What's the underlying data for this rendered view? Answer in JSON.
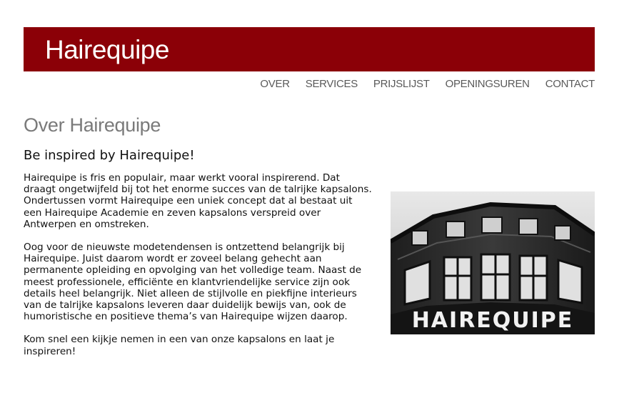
{
  "header": {
    "logo_text": "Hairequipe",
    "background_color": "#8b0007"
  },
  "nav": {
    "items": [
      {
        "label": "OVER"
      },
      {
        "label": "SERVICES"
      },
      {
        "label": "PRIJSLIJST"
      },
      {
        "label": "OPENINGSUREN"
      },
      {
        "label": "CONTACT"
      }
    ]
  },
  "main": {
    "title": "Over Hairequipe",
    "subheading": "Be inspired by Hairequipe!",
    "paragraphs": [
      "Hairequipe is fris en populair, maar werkt vooral inspirerend. Dat draagt ongetwijfeld bij tot het enorme succes van de talrijke kapsalons. Ondertussen vormt Hairequipe een uniek concept dat al bestaat uit een Hairequipe Academie en zeven kapsalons verspreid over Antwerpen en omstreken.",
      "Oog voor de nieuwste modetendensen is ontzettend belangrijk bij Hairequipe. Juist daarom wordt er zoveel belang gehecht aan permanente opleiding en opvolging van het volledige team. Naast de meest professionele, efficiënte en klantvriendelijke service zijn ook details heel belangrijk. Niet alleen de stijlvolle en piekfijne interieurs van de talrijke kapsalons leveren daar duidelijk bewijs van, ook de humoristische en positieve thema’s van Hairequipe wijzen daarop.",
      "Kom snel een kijkje nemen in een van onze kapsalons en laat je inspireren!"
    ]
  },
  "photo": {
    "sign_text": "HAIREQUIPE"
  }
}
